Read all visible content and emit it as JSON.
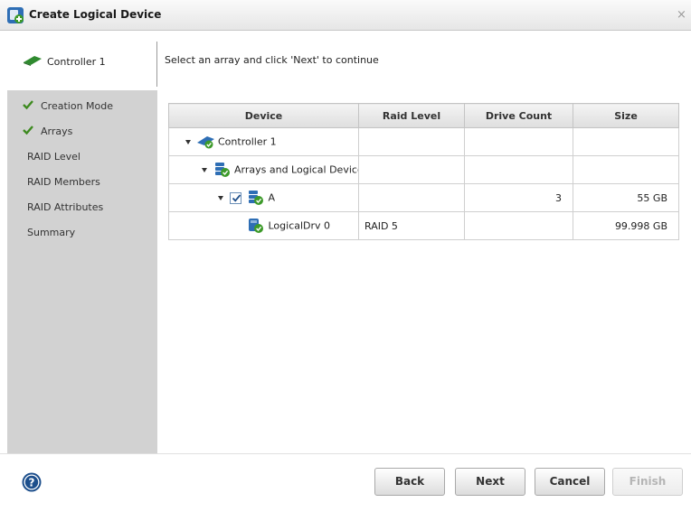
{
  "window": {
    "title": "Create Logical Device",
    "close_glyph": "×",
    "app_icon": "add-logical-device-icon"
  },
  "header": {
    "controller_label": "Controller 1",
    "controller_icon": "controller-card-icon",
    "instruction": "Select an array and click 'Next' to continue"
  },
  "steps": [
    {
      "label": "Creation Mode",
      "done": true
    },
    {
      "label": "Arrays",
      "done": true
    },
    {
      "label": "RAID Level",
      "done": false
    },
    {
      "label": "RAID Members",
      "done": false
    },
    {
      "label": "RAID Attributes",
      "done": false
    },
    {
      "label": "Summary",
      "done": false
    }
  ],
  "table": {
    "columns": [
      "Device",
      "Raid Level",
      "Drive Count",
      "Size"
    ],
    "rows": [
      {
        "device": "Controller 1",
        "raid_level": "",
        "drive_count": "",
        "size": "",
        "icon": "controller-icon",
        "indent": 0,
        "expanded": true,
        "checkbox": false
      },
      {
        "device": "Arrays and Logical Devices",
        "raid_level": "",
        "drive_count": "",
        "size": "",
        "icon": "arrays-icon",
        "indent": 1,
        "expanded": true,
        "checkbox": false
      },
      {
        "device": "A",
        "raid_level": "",
        "drive_count": "3",
        "size": "55 GB",
        "icon": "array-icon",
        "indent": 2,
        "expanded": true,
        "checkbox": true,
        "checked": true
      },
      {
        "device": "LogicalDrv 0",
        "raid_level": "RAID 5",
        "drive_count": "",
        "size": "99.998 GB",
        "icon": "logical-drive-icon",
        "indent": 3,
        "expanded": false,
        "checkbox": false
      }
    ]
  },
  "footer": {
    "help_icon": "help-icon",
    "back_label": "Back",
    "next_label": "Next",
    "cancel_label": "Cancel",
    "finish_label": "Finish"
  },
  "colors": {
    "sidebar_bg": "#d2d2d2",
    "check_green": "#3d8a1f",
    "icon_blue": "#2e6eb5",
    "help_blue": "#1d4f8c"
  }
}
